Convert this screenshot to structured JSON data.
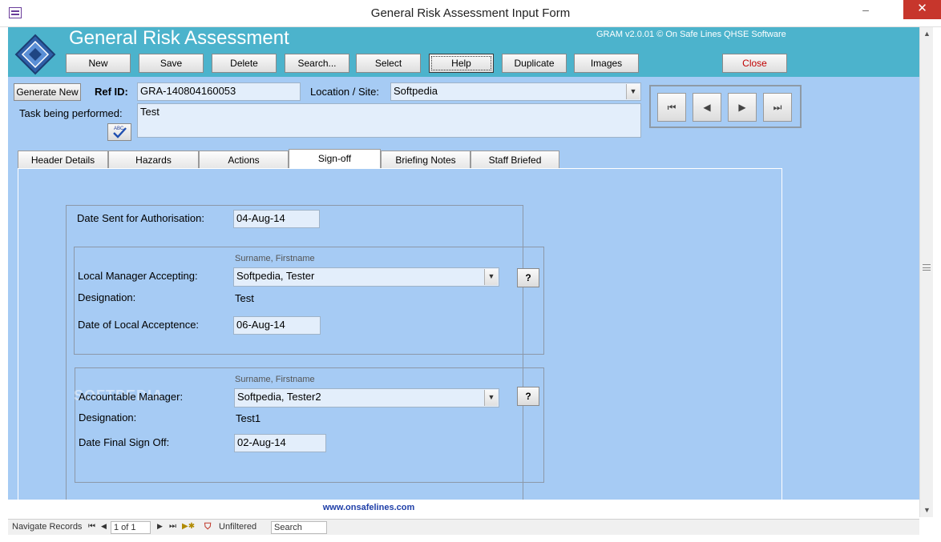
{
  "window": {
    "title": "General Risk Assessment Input Form",
    "minimize_glyph": "–",
    "close_glyph": "✕"
  },
  "header": {
    "form_title": "General Risk Assessment",
    "version": "GRAM v2.0.01 © On Safe Lines QHSE Software",
    "logo_icon": "diamond-logo-icon",
    "brand_color": "#4cb3cc"
  },
  "toolbar": {
    "new": "New",
    "save": "Save",
    "delete": "Delete",
    "search": "Search...",
    "select": "Select",
    "help": "Help",
    "duplicate": "Duplicate",
    "images": "Images",
    "close": "Close"
  },
  "record": {
    "generate_new": "Generate New",
    "ref_id_label": "Ref ID:",
    "ref_id_value": "GRA-140804160053",
    "location_label": "Location / Site:",
    "location_value": "Softpedia",
    "task_label": "Task being performed:",
    "task_value": "Test",
    "spellcheck_icon": "spell-check-icon"
  },
  "navigation": {
    "first_icon": "first-record-icon",
    "prev_icon": "previous-record-icon",
    "next_icon": "next-record-icon",
    "last_icon": "last-record-icon",
    "first_glyph": "⏮",
    "prev_glyph": "◀",
    "next_glyph": "▶",
    "last_glyph": "⏭"
  },
  "tabs": [
    {
      "label": "Header Details",
      "active": false
    },
    {
      "label": "Hazards",
      "active": false
    },
    {
      "label": "Actions",
      "active": false
    },
    {
      "label": "Sign-off",
      "active": true
    },
    {
      "label": "Briefing Notes",
      "active": false
    },
    {
      "label": "Staff Briefed",
      "active": false
    }
  ],
  "signoff": {
    "date_sent_label": "Date Sent for Authorisation:",
    "date_sent_value": "04-Aug-14",
    "local": {
      "hint": "Surname, Firstname",
      "manager_label": "Local Manager Accepting:",
      "manager_value": "Softpedia, Tester",
      "designation_label": "Designation:",
      "designation_value": "Test",
      "date_label": "Date of Local Acceptence:",
      "date_value": "06-Aug-14",
      "help_label": "?"
    },
    "accountable": {
      "hint": "Surname, Firstname",
      "manager_label": "Accountable Manager:",
      "manager_value": "Softpedia, Tester2",
      "designation_label": "Designation:",
      "designation_value": "Test1",
      "date_label": "Date Final Sign Off:",
      "date_value": "02-Aug-14",
      "help_label": "?"
    }
  },
  "watermark": "SOFTPEDIA",
  "footer": {
    "website": "www.onsafelines.com"
  },
  "statusbar": {
    "navigate_label": "Navigate Records",
    "record_position": "1 of 1",
    "filter_label": "Unfiltered",
    "search_placeholder": "Search"
  },
  "colors": {
    "form_background": "#a6cbf4",
    "field_background": "#e3eefb",
    "close_button_text": "#c00000"
  }
}
